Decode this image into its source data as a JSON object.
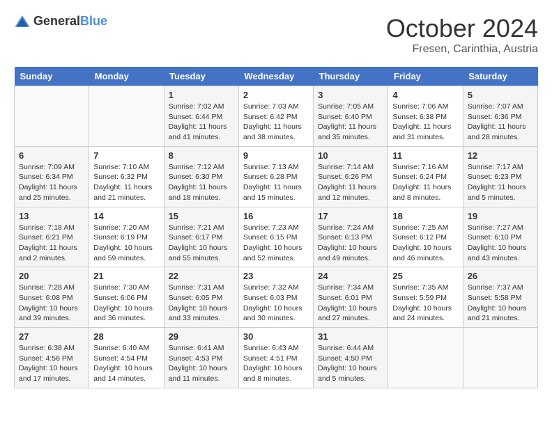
{
  "header": {
    "logo_general": "General",
    "logo_blue": "Blue",
    "month": "October 2024",
    "location": "Fresen, Carinthia, Austria"
  },
  "days_of_week": [
    "Sunday",
    "Monday",
    "Tuesday",
    "Wednesday",
    "Thursday",
    "Friday",
    "Saturday"
  ],
  "weeks": [
    [
      {
        "day": "",
        "info": ""
      },
      {
        "day": "",
        "info": ""
      },
      {
        "day": "1",
        "info": "Sunrise: 7:02 AM\nSunset: 6:44 PM\nDaylight: 11 hours and 41 minutes."
      },
      {
        "day": "2",
        "info": "Sunrise: 7:03 AM\nSunset: 6:42 PM\nDaylight: 11 hours and 38 minutes."
      },
      {
        "day": "3",
        "info": "Sunrise: 7:05 AM\nSunset: 6:40 PM\nDaylight: 11 hours and 35 minutes."
      },
      {
        "day": "4",
        "info": "Sunrise: 7:06 AM\nSunset: 6:38 PM\nDaylight: 11 hours and 31 minutes."
      },
      {
        "day": "5",
        "info": "Sunrise: 7:07 AM\nSunset: 6:36 PM\nDaylight: 11 hours and 28 minutes."
      }
    ],
    [
      {
        "day": "6",
        "info": "Sunrise: 7:09 AM\nSunset: 6:34 PM\nDaylight: 11 hours and 25 minutes."
      },
      {
        "day": "7",
        "info": "Sunrise: 7:10 AM\nSunset: 6:32 PM\nDaylight: 11 hours and 21 minutes."
      },
      {
        "day": "8",
        "info": "Sunrise: 7:12 AM\nSunset: 6:30 PM\nDaylight: 11 hours and 18 minutes."
      },
      {
        "day": "9",
        "info": "Sunrise: 7:13 AM\nSunset: 6:28 PM\nDaylight: 11 hours and 15 minutes."
      },
      {
        "day": "10",
        "info": "Sunrise: 7:14 AM\nSunset: 6:26 PM\nDaylight: 11 hours and 12 minutes."
      },
      {
        "day": "11",
        "info": "Sunrise: 7:16 AM\nSunset: 6:24 PM\nDaylight: 11 hours and 8 minutes."
      },
      {
        "day": "12",
        "info": "Sunrise: 7:17 AM\nSunset: 6:23 PM\nDaylight: 11 hours and 5 minutes."
      }
    ],
    [
      {
        "day": "13",
        "info": "Sunrise: 7:18 AM\nSunset: 6:21 PM\nDaylight: 11 hours and 2 minutes."
      },
      {
        "day": "14",
        "info": "Sunrise: 7:20 AM\nSunset: 6:19 PM\nDaylight: 10 hours and 59 minutes."
      },
      {
        "day": "15",
        "info": "Sunrise: 7:21 AM\nSunset: 6:17 PM\nDaylight: 10 hours and 55 minutes."
      },
      {
        "day": "16",
        "info": "Sunrise: 7:23 AM\nSunset: 6:15 PM\nDaylight: 10 hours and 52 minutes."
      },
      {
        "day": "17",
        "info": "Sunrise: 7:24 AM\nSunset: 6:13 PM\nDaylight: 10 hours and 49 minutes."
      },
      {
        "day": "18",
        "info": "Sunrise: 7:25 AM\nSunset: 6:12 PM\nDaylight: 10 hours and 46 minutes."
      },
      {
        "day": "19",
        "info": "Sunrise: 7:27 AM\nSunset: 6:10 PM\nDaylight: 10 hours and 43 minutes."
      }
    ],
    [
      {
        "day": "20",
        "info": "Sunrise: 7:28 AM\nSunset: 6:08 PM\nDaylight: 10 hours and 39 minutes."
      },
      {
        "day": "21",
        "info": "Sunrise: 7:30 AM\nSunset: 6:06 PM\nDaylight: 10 hours and 36 minutes."
      },
      {
        "day": "22",
        "info": "Sunrise: 7:31 AM\nSunset: 6:05 PM\nDaylight: 10 hours and 33 minutes."
      },
      {
        "day": "23",
        "info": "Sunrise: 7:32 AM\nSunset: 6:03 PM\nDaylight: 10 hours and 30 minutes."
      },
      {
        "day": "24",
        "info": "Sunrise: 7:34 AM\nSunset: 6:01 PM\nDaylight: 10 hours and 27 minutes."
      },
      {
        "day": "25",
        "info": "Sunrise: 7:35 AM\nSunset: 5:59 PM\nDaylight: 10 hours and 24 minutes."
      },
      {
        "day": "26",
        "info": "Sunrise: 7:37 AM\nSunset: 5:58 PM\nDaylight: 10 hours and 21 minutes."
      }
    ],
    [
      {
        "day": "27",
        "info": "Sunrise: 6:38 AM\nSunset: 4:56 PM\nDaylight: 10 hours and 17 minutes."
      },
      {
        "day": "28",
        "info": "Sunrise: 6:40 AM\nSunset: 4:54 PM\nDaylight: 10 hours and 14 minutes."
      },
      {
        "day": "29",
        "info": "Sunrise: 6:41 AM\nSunset: 4:53 PM\nDaylight: 10 hours and 11 minutes."
      },
      {
        "day": "30",
        "info": "Sunrise: 6:43 AM\nSunset: 4:51 PM\nDaylight: 10 hours and 8 minutes."
      },
      {
        "day": "31",
        "info": "Sunrise: 6:44 AM\nSunset: 4:50 PM\nDaylight: 10 hours and 5 minutes."
      },
      {
        "day": "",
        "info": ""
      },
      {
        "day": "",
        "info": ""
      }
    ]
  ]
}
